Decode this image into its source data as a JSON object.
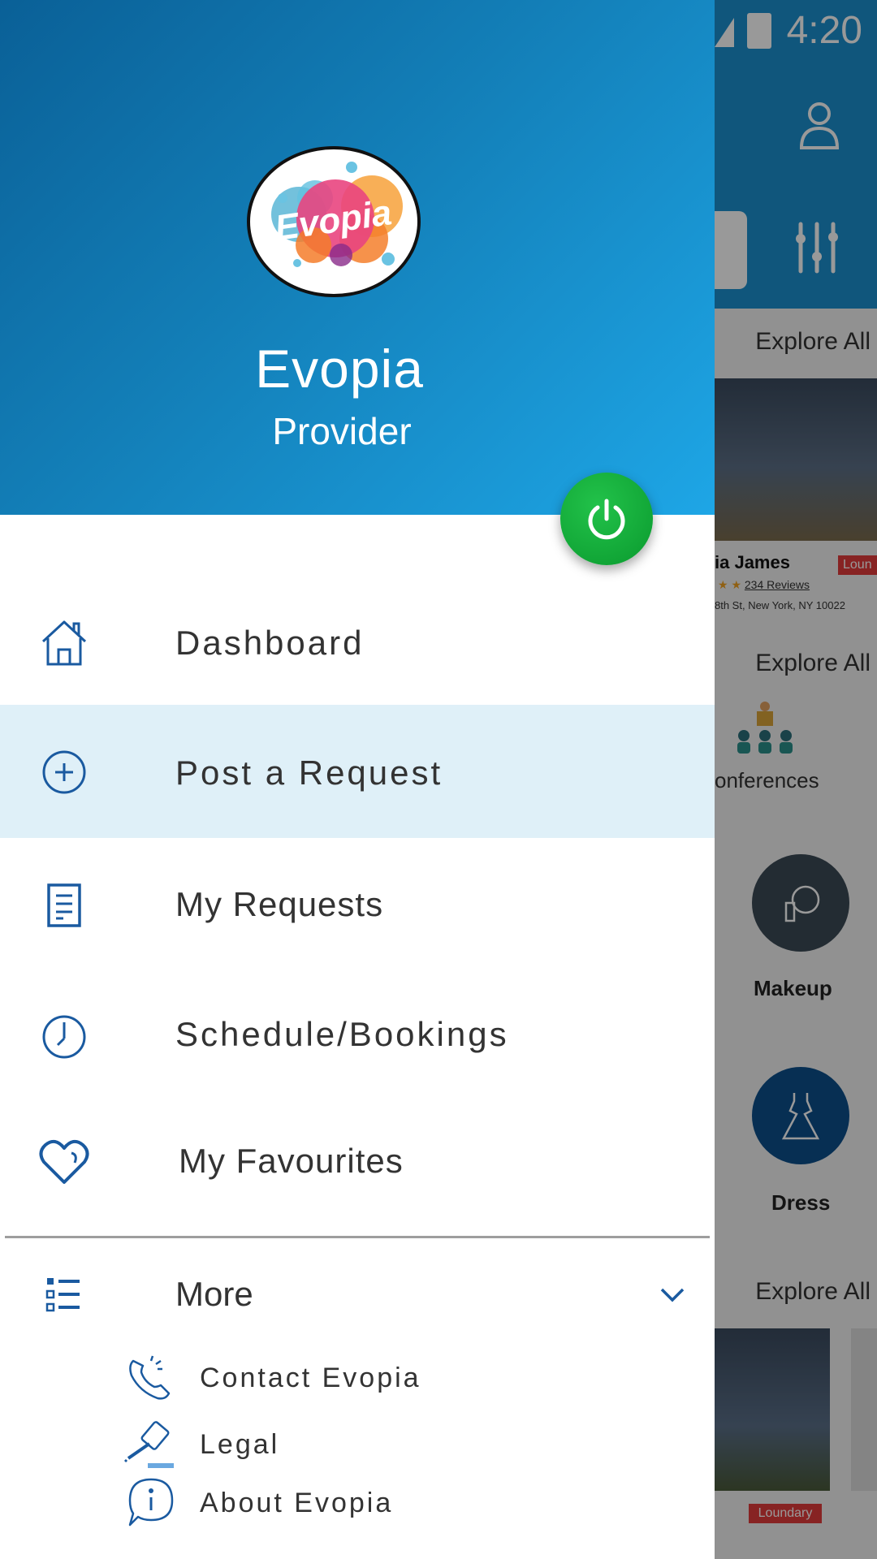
{
  "background": {
    "status_time": "4:20",
    "explore_label": "Explore All",
    "card1": {
      "name": "ia James",
      "tag": "Loun",
      "reviews": "234 Reviews",
      "address": "8th St, New York, NY 10022"
    },
    "conferences_label": "onferences",
    "categories": [
      {
        "label": "Makeup",
        "icon": "makeup-icon",
        "color": "#3b4a55"
      },
      {
        "label": "Dress",
        "icon": "dress-icon",
        "color": "#0d4f8b"
      }
    ],
    "card2": {
      "tag": "Loundary"
    }
  },
  "drawer": {
    "brand_name": "Evopia",
    "brand_role": "Provider",
    "logo_text": "Evopia",
    "accent_color": "#1a5aa0",
    "power_color": "#13b03c",
    "items": [
      {
        "label": "Dashboard",
        "icon": "home-icon",
        "active": false
      },
      {
        "label": "Post a Request",
        "icon": "plus-circle-icon",
        "active": true
      },
      {
        "label": "My Requests",
        "icon": "document-icon",
        "active": false
      },
      {
        "label": "Schedule/Bookings",
        "icon": "clock-icon",
        "active": false
      },
      {
        "label": "My Favourites",
        "icon": "heart-icon",
        "active": false
      }
    ],
    "more": {
      "label": "More",
      "icon": "list-icon",
      "expanded": true,
      "sub_items": [
        {
          "label": "Contact Evopia",
          "icon": "phone-icon"
        },
        {
          "label": "Legal",
          "icon": "gavel-icon"
        },
        {
          "label": "About Evopia",
          "icon": "info-bubble-icon"
        }
      ]
    }
  }
}
